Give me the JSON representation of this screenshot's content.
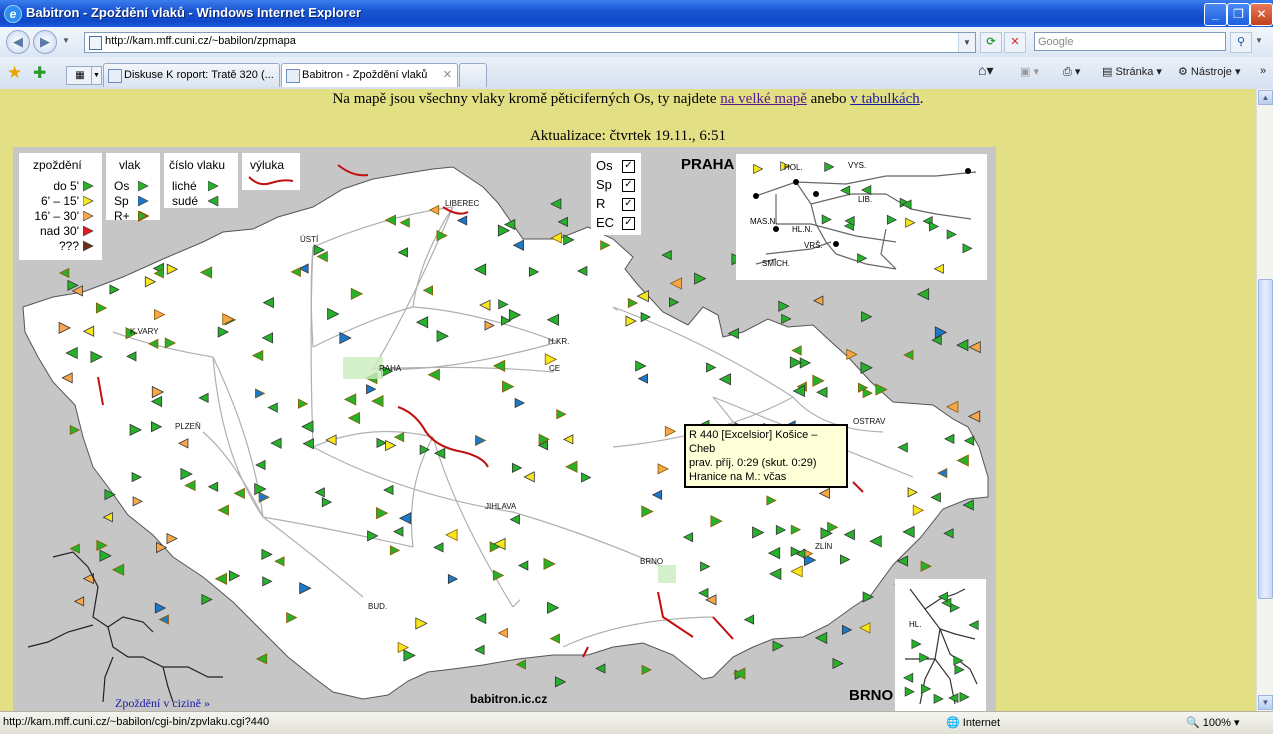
{
  "window": {
    "title": "Babitron - Zpoždění vlaků - Windows Internet Explorer",
    "minimize": "_",
    "restore": "❐",
    "close": "✕"
  },
  "address": {
    "url": "http://kam.mff.cuni.cz/~babilon/zpmapa",
    "search_placeholder": "Google"
  },
  "tabs": [
    {
      "label": "Diskuse K roport: Tratě 320 (..."
    },
    {
      "label": "Babitron - Zpoždění vlaků"
    }
  ],
  "toolbar": {
    "page_label": "Stránka",
    "tools_label": "Nástroje"
  },
  "page": {
    "intro_text": "Na mapě jsou všechny vlaky kromě pěticiferných Os, ty najdete",
    "link_big_map": "na velké mapě",
    "and_text": "anebo",
    "link_tables": "v tabulkách",
    "update": "Aktualizace: čtvrtek 19.11., 6:51",
    "foreign_link": "Zpoždění v cizině »",
    "site_label": "babitron.ic.cz"
  },
  "legend": {
    "delay_title": "zpoždění",
    "delay_items": [
      {
        "label": "do 5'",
        "color": "#27b12a"
      },
      {
        "label": "6' – 15'",
        "color": "#f6e61c"
      },
      {
        "label": "16' – 30'",
        "color": "#f7a64a"
      },
      {
        "label": "nad 30'",
        "color": "#e8191c"
      },
      {
        "label": "???",
        "color": "#6b2e1a"
      }
    ],
    "train_title": "vlak",
    "train_items": [
      {
        "label": "Os",
        "color": "#27b12a"
      },
      {
        "label": "Sp",
        "color": "#1c78c8"
      },
      {
        "label": "R+",
        "color": "#27b12a"
      }
    ],
    "number_title": "číslo vlaku",
    "number_items": [
      {
        "label": "liché"
      },
      {
        "label": "sudé"
      }
    ],
    "closure_title": "výluka",
    "filters": [
      {
        "label": "Os",
        "checked": true
      },
      {
        "label": "Sp",
        "checked": true
      },
      {
        "label": "R",
        "checked": true
      },
      {
        "label": "EC",
        "checked": true
      }
    ]
  },
  "map": {
    "cities": [
      "K.VARY",
      "PLZEŇ",
      "ÚSTÍ",
      "LIBEREC",
      "RAHA",
      "H.KR.",
      "CE",
      "JIHLAVA",
      "BRNO",
      "OLOM.",
      "OSTRAV",
      "ZLÍN",
      "BUD."
    ],
    "inset_praha_title": "PRAHA",
    "inset_praha_labels": [
      "HOL.",
      "VYS.",
      "LIB.",
      "MAS.N.",
      "HL.N.",
      "VRŠ.",
      "SMÍCH."
    ],
    "inset_brno_title": "BRNO",
    "inset_brno_labels": [
      "HL."
    ]
  },
  "tooltip": {
    "line1": "R 440 [Excelsior] Košice – Cheb",
    "line2": "prav. příj. 0:29 (skut. 0:29)",
    "line3": "Hranice na M.: včas"
  },
  "status": {
    "url": "http://kam.mff.cuni.cz/~babilon/cgi-bin/zpvlaku.cgi?440",
    "zone": "Internet",
    "zoom": "100%"
  }
}
